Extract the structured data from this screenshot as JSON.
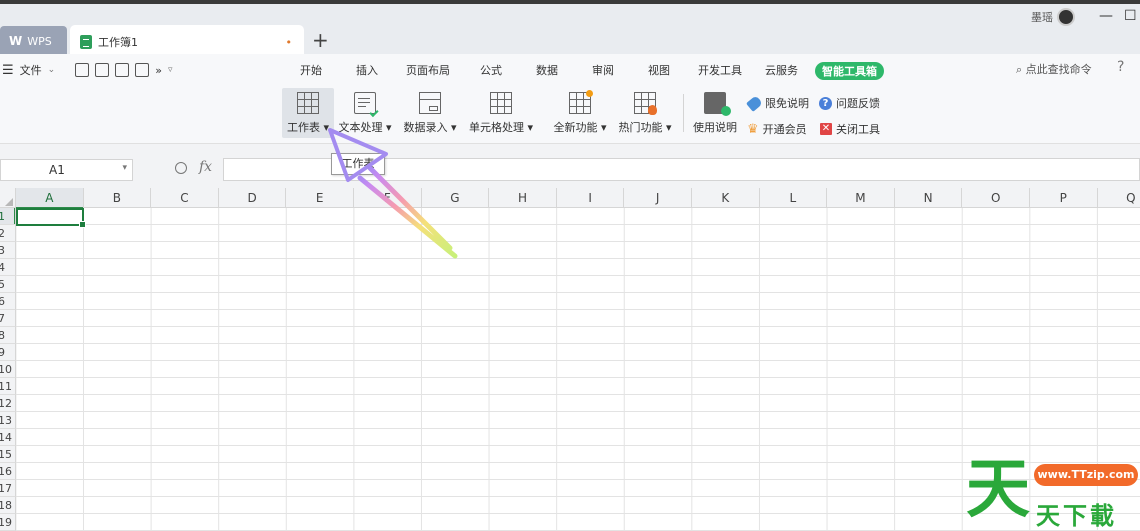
{
  "tabs": {
    "app_label": "WPS",
    "doc_title": "工作簿1",
    "modified_dot": "•",
    "add": "+"
  },
  "user": {
    "name": "墨瑶"
  },
  "window": {
    "minimize": "—",
    "maximize": "☐"
  },
  "menu": {
    "file": "文件",
    "more": "»",
    "tabs": [
      "开始",
      "插入",
      "页面布局",
      "公式",
      "数据",
      "审阅",
      "视图",
      "开发工具",
      "云服务",
      "智能工具箱"
    ],
    "search_cmd": "点此查找命令",
    "help": "?"
  },
  "ribbon": {
    "worksheet": "工作表",
    "text_process": "文本处理",
    "data_entry": "数据录入",
    "cell_process": "单元格处理",
    "new_feature": "全新功能",
    "hot_feature": "热门功能",
    "usage": "使用说明",
    "disclaimer": "限免说明",
    "feedback": "问题反馈",
    "vip": "开通会员",
    "close_tool": "关闭工具"
  },
  "formula_bar": {
    "cell_ref": "A1",
    "fx": "fx",
    "value": ""
  },
  "tooltip": "工作表",
  "sheet": {
    "columns": [
      "A",
      "B",
      "C",
      "D",
      "E",
      "F",
      "G",
      "H",
      "I",
      "J",
      "K",
      "L",
      "M",
      "N",
      "O",
      "P",
      "Q"
    ],
    "rows": [
      "1",
      "2",
      "3",
      "4",
      "5",
      "6",
      "7",
      "8",
      "9",
      "10",
      "11",
      "12",
      "13",
      "14",
      "15",
      "16",
      "17",
      "18",
      "19"
    ],
    "selected_col": "A",
    "selected_row": "1"
  },
  "watermark": {
    "glyph": "天",
    "url": "www.TTzip.com",
    "name": "天下載"
  },
  "colors": {
    "accent_green": "#2eb86a",
    "sheet_green": "#1e7e3e",
    "watermark_green": "#2aa83a",
    "watermark_orange": "#f26a2a"
  }
}
